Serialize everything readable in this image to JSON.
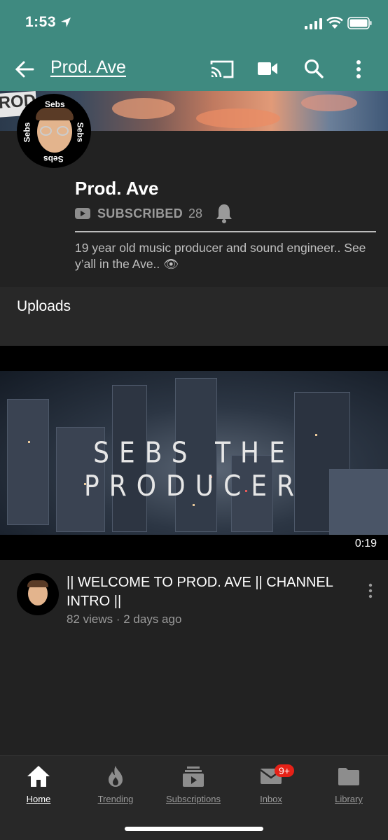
{
  "status": {
    "time": "1:53"
  },
  "appbar": {
    "title": "Prod. Ave",
    "icons": [
      "back-arrow-icon",
      "cast-icon",
      "camera-icon",
      "search-icon",
      "more-vert-icon"
    ]
  },
  "banner": {
    "sign_text": "ROD"
  },
  "avatar": {
    "ring_text": "Sebs"
  },
  "channel": {
    "name": "Prod. Ave",
    "subscribed_label": "SUBSCRIBED",
    "subscriber_count": "28",
    "description": "19 year old music producer and sound engineer.. See y’all in the Ave.. 👁"
  },
  "section": {
    "uploads_label": "Uploads"
  },
  "video": {
    "overlay_title": "SEBS THE PRODUCER",
    "duration": "0:19",
    "progress_fraction": 0.1,
    "title": "|| WELCOME TO PROD. AVE || CHANNEL INTRO ||",
    "meta": "82 views · 2 days ago"
  },
  "nav": {
    "items": [
      {
        "label": "Home",
        "icon": "home-icon"
      },
      {
        "label": "Trending",
        "icon": "flame-icon"
      },
      {
        "label": "Subscriptions",
        "icon": "subscriptions-icon"
      },
      {
        "label": "Inbox",
        "icon": "inbox-icon",
        "badge": "9+"
      },
      {
        "label": "Library",
        "icon": "folder-icon"
      }
    ]
  },
  "colors": {
    "header": "#3f8a80",
    "background": "#222222",
    "accent_red": "#e62117"
  }
}
